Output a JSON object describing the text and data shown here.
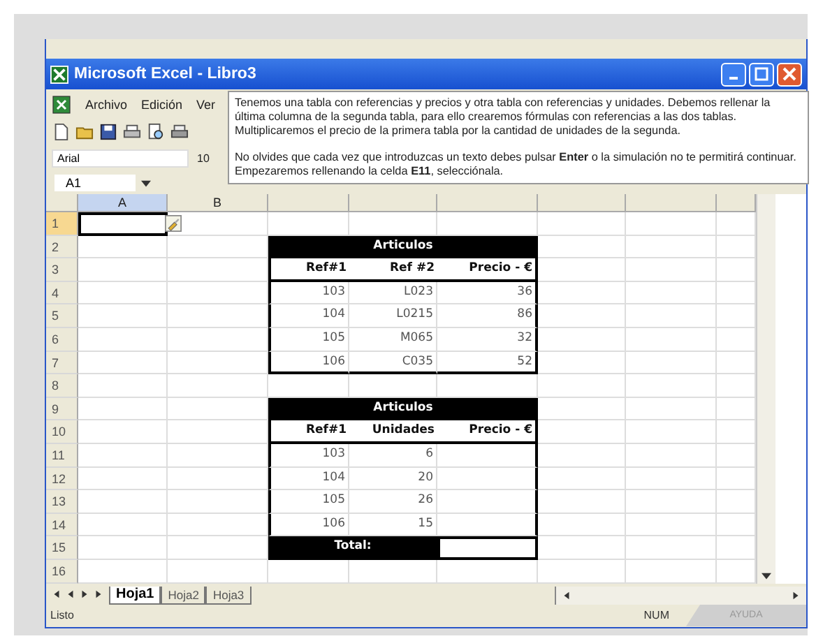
{
  "window": {
    "title": "Microsoft Excel - Libro3"
  },
  "menu": [
    {
      "label": "Archivo"
    },
    {
      "label": "Edición"
    },
    {
      "label": "Ver"
    }
  ],
  "format_toolbar": {
    "font": "Arial",
    "size": "10"
  },
  "name_box": "A1",
  "tooltip": {
    "paragraphs": [
      "Tenemos una tabla con referencias y precios y otra tabla con referencias y unidades. Debemos rellenar la última columna de la segunda tabla, para ello crearemos fórmulas con referencias a las dos tablas. Multiplicaremos el precio de la primera tabla por la cantidad de unidades de la segunda.",
      "No olvides que cada vez que introduzcas un texto debes pulsar **Enter** o la simulación no te permitirá continuar. Empezaremos rellenando la celda **E11**, selecciónala."
    ]
  },
  "columns": [
    {
      "label": "A",
      "selected": true
    },
    {
      "label": "B",
      "selected": false
    }
  ],
  "rows": [
    {
      "label": "1",
      "selected": true
    },
    {
      "label": "2",
      "selected": false
    },
    {
      "label": "3",
      "selected": false
    },
    {
      "label": "4",
      "selected": false
    },
    {
      "label": "5",
      "selected": false
    },
    {
      "label": "6",
      "selected": false
    },
    {
      "label": "7",
      "selected": false
    },
    {
      "label": "8",
      "selected": false
    },
    {
      "label": "9",
      "selected": false
    },
    {
      "label": "10",
      "selected": false
    },
    {
      "label": "11",
      "selected": false
    },
    {
      "label": "12",
      "selected": false
    },
    {
      "label": "13",
      "selected": false
    },
    {
      "label": "14",
      "selected": false
    },
    {
      "label": "15",
      "selected": false
    },
    {
      "label": "16",
      "selected": false
    }
  ],
  "tables": [
    {
      "title": "Articulos",
      "headers": [
        "Ref#1",
        "Ref #2",
        "Precio - €"
      ],
      "rows": [
        [
          "103",
          "L023",
          "36"
        ],
        [
          "104",
          "L0215",
          "86"
        ],
        [
          "105",
          "M065",
          "32"
        ],
        [
          "106",
          "C035",
          "52"
        ]
      ]
    },
    {
      "title": "Articulos",
      "headers": [
        "Ref#1",
        "Unidades",
        "Precio - €"
      ],
      "rows": [
        [
          "103",
          "6"
        ],
        [
          "104",
          "20"
        ],
        [
          "105",
          "26"
        ],
        [
          "106",
          "15"
        ]
      ],
      "total_label": "Total:"
    }
  ],
  "sheet_tabs": [
    {
      "label": "Hoja1",
      "selected": true
    },
    {
      "label": "Hoja2",
      "selected": false
    },
    {
      "label": "Hoja3",
      "selected": false
    }
  ],
  "status_bar": {
    "status": "Listo",
    "indicator": "NUM",
    "help_button": "AYUDA"
  }
}
